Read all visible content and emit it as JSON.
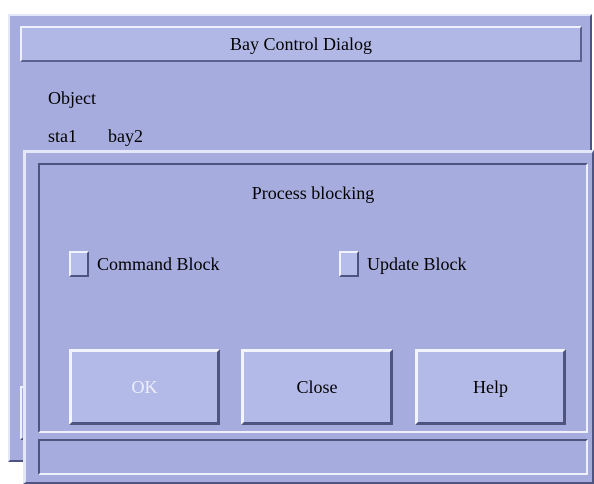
{
  "window": {
    "title": "Bay Control Dialog"
  },
  "object": {
    "label": "Object",
    "station": "sta1",
    "bay": "bay2"
  },
  "process_blocking": {
    "title": "Process blocking",
    "command_block_label": "Command Block",
    "update_block_label": "Update Block",
    "command_block_checked": false,
    "update_block_checked": false
  },
  "buttons": {
    "ok": "OK",
    "close": "Close",
    "help": "Help",
    "ok_enabled": false
  },
  "colors": {
    "background": "#a6acdd",
    "highlight": "#e4e7fa",
    "shadow": "#4e547f",
    "disabled_text": "#edeffa"
  }
}
